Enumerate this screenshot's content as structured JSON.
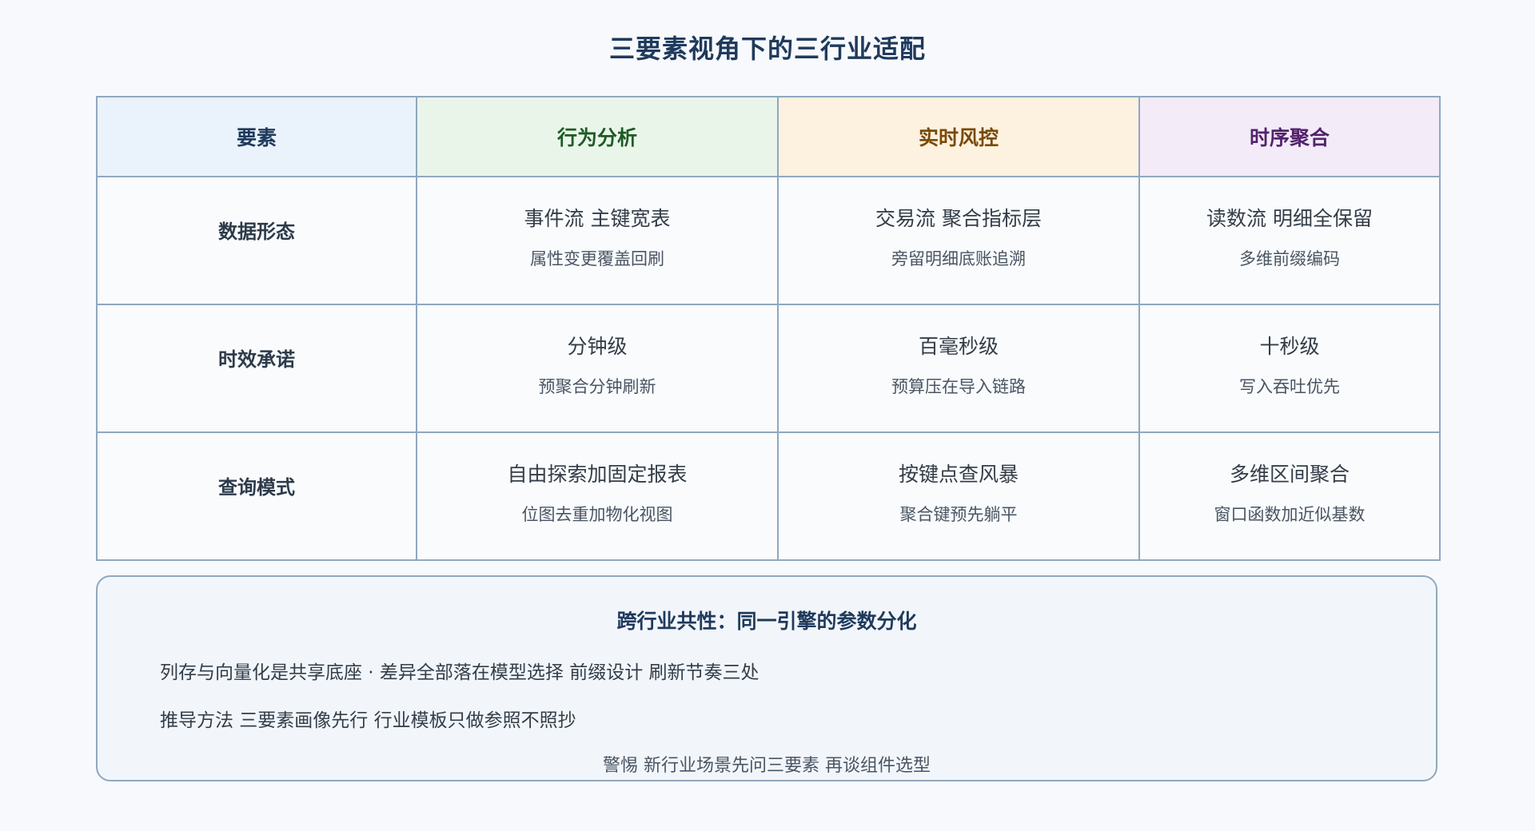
{
  "title": "三要素视角下的三行业适配",
  "header": {
    "factor": "要素",
    "columns": [
      "行为分析",
      "实时风控",
      "时序聚合"
    ]
  },
  "colors": {
    "factor": "#eaf2fc",
    "behavior": "#eaf5ea",
    "risk": "#fdf2e0",
    "timeseries": "#f3ebf7"
  },
  "rows": [
    {
      "label": "数据形态",
      "cells": [
        {
          "main": "事件流 主键宽表",
          "sub": "属性变更覆盖回刷"
        },
        {
          "main": "交易流 聚合指标层",
          "sub": "旁留明细底账追溯"
        },
        {
          "main": "读数流 明细全保留",
          "sub": "多维前缀编码"
        }
      ]
    },
    {
      "label": "时效承诺",
      "cells": [
        {
          "main": "分钟级",
          "sub": "预聚合分钟刷新"
        },
        {
          "main": "百毫秒级",
          "sub": "预算压在导入链路"
        },
        {
          "main": "十秒级",
          "sub": "写入吞吐优先"
        }
      ]
    },
    {
      "label": "查询模式",
      "cells": [
        {
          "main": "自由探索加固定报表",
          "sub": "位图去重加物化视图"
        },
        {
          "main": "按键点查风暴",
          "sub": "聚合键预先躺平"
        },
        {
          "main": "多维区间聚合",
          "sub": "窗口函数加近似基数"
        }
      ]
    }
  ],
  "summary": {
    "title": "跨行业共性：同一引擎的参数分化",
    "line1": "列存与向量化是共享底座 · 差异全部落在模型选择 前缀设计 刷新节奏三处",
    "line2": "推导方法 三要素画像先行 行业模板只做参照不照抄",
    "warning": "警惕 新行业场景先问三要素 再谈组件选型"
  }
}
